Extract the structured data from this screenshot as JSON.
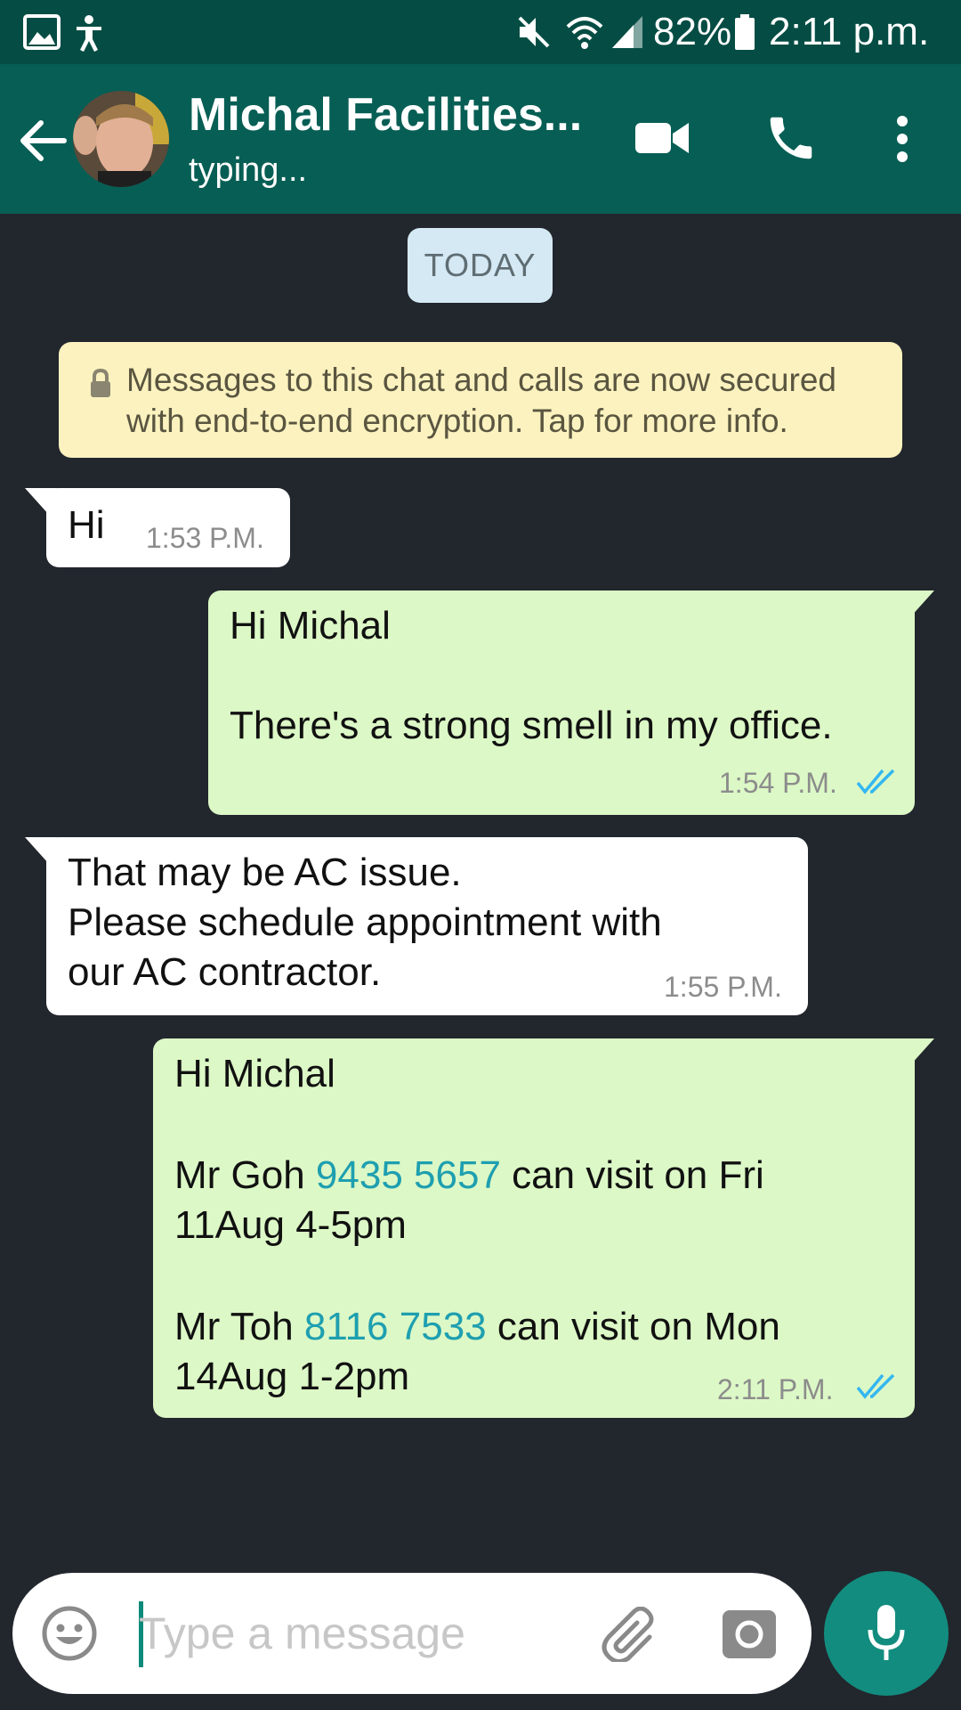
{
  "status_bar": {
    "battery": "82%",
    "time": "2:11 p.m."
  },
  "header": {
    "contact_name": "Michal Facilities...",
    "status": "typing..."
  },
  "chat": {
    "date_chip": "TODAY",
    "encryption_notice": "Messages to this chat and calls are now secured with end-to-end encryption. Tap for more info.",
    "messages": [
      {
        "direction": "incoming",
        "text": "Hi",
        "time": "1:53 P.M."
      },
      {
        "direction": "outgoing",
        "text": "Hi Michal\n\nThere's a strong smell in my office.",
        "time": "1:54 P.M.",
        "read": true
      },
      {
        "direction": "incoming",
        "text": "That may be AC issue.\nPlease schedule appointment with\nour AC contractor.",
        "time": "1:55 P.M."
      },
      {
        "direction": "outgoing",
        "greeting": "Hi Michal",
        "line1_a": "Mr Goh ",
        "line1_phone": "9435 5657",
        "line1_b": " can visit on Fri",
        "line1_c": "11Aug 4-5pm",
        "line2_a": "Mr Toh ",
        "line2_phone": "8116 7533",
        "line2_b": " can visit on Mon",
        "line2_c": "14Aug 1-2pm",
        "time": "2:11 P.M.",
        "read": true
      }
    ]
  },
  "composer": {
    "placeholder": "Type a message"
  },
  "colors": {
    "header": "#075e54",
    "status_bar": "#054d44",
    "background": "#22262d",
    "outgoing_bubble": "#dcf8c6",
    "incoming_bubble": "#ffffff",
    "link": "#1e9fb0",
    "read_ticks": "#34b7f1",
    "mic_button": "#128c7e"
  },
  "icons": [
    "gallery-icon",
    "accessibility-icon",
    "mute-icon",
    "wifi-icon",
    "signal-icon",
    "battery-icon",
    "back-arrow-icon",
    "avatar",
    "video-call-icon",
    "voice-call-icon",
    "more-options-icon",
    "lock-icon",
    "double-check-icon",
    "emoji-icon",
    "attach-icon",
    "camera-icon",
    "mic-icon"
  ]
}
